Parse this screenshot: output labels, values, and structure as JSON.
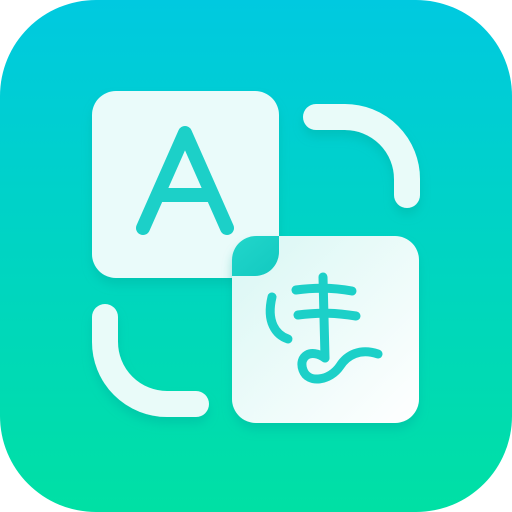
{
  "app_icon": {
    "kind": "translator-app-icon",
    "source_glyph": "A",
    "target_glyph": "ま",
    "icons": {
      "background": "rounded-square-icon",
      "source_card": "latin-letter-card-icon",
      "target_card": "japanese-kana-card-icon",
      "corner_brackets": "scan-frame-bracket-icon"
    },
    "colors": {
      "background_top": "#00C9E0",
      "background_bottom": "#00E0A4",
      "card_fill": "#EAFBFA",
      "glyph": "#1CD0C8",
      "bracket": "#E9FBF9",
      "shadow": "#00A99A"
    }
  }
}
